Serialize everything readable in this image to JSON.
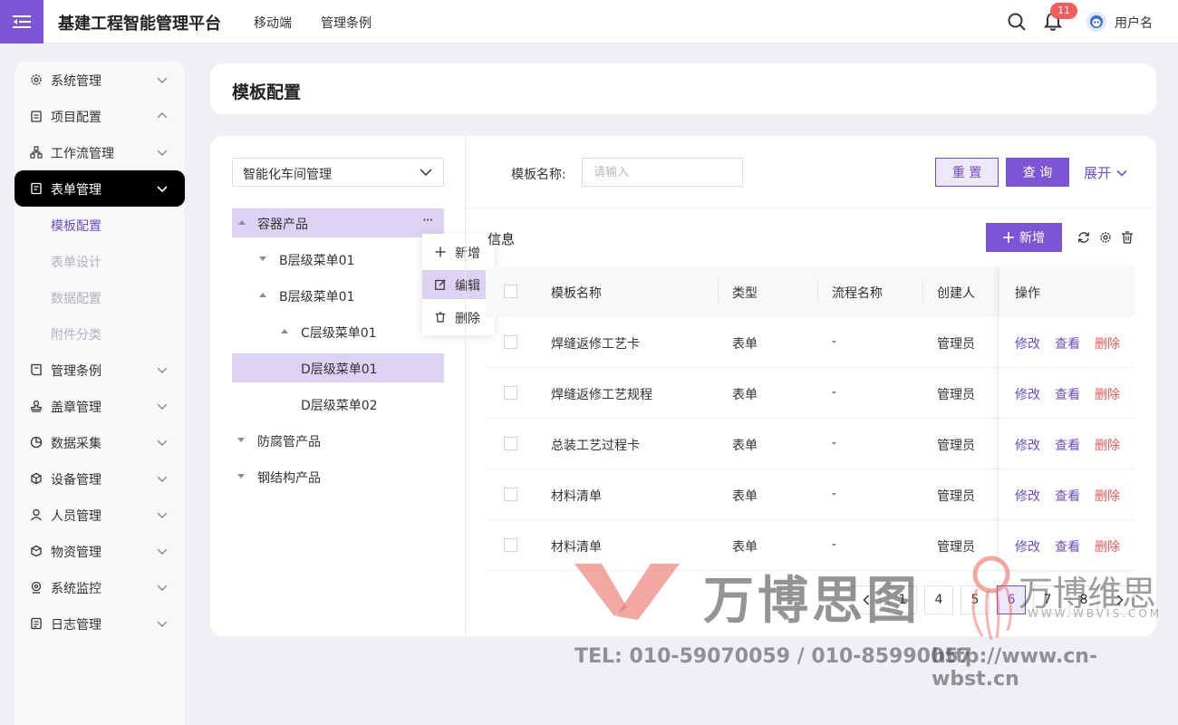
{
  "app": {
    "title": "基建工程智能管理平台"
  },
  "topnav": [
    "移动端",
    "管理条例"
  ],
  "header": {
    "notification_count": "11",
    "username": "用户名"
  },
  "sidebar": {
    "items": [
      {
        "label": "系统管理",
        "icon": "gear-icon"
      },
      {
        "label": "项目配置",
        "icon": "clipboard-icon"
      },
      {
        "label": "工作流管理",
        "icon": "workflow-icon"
      },
      {
        "label": "表单管理",
        "icon": "form-icon"
      },
      {
        "label": "管理条例",
        "icon": "rules-icon"
      },
      {
        "label": "盖章管理",
        "icon": "stamp-icon"
      },
      {
        "label": "数据采集",
        "icon": "pie-icon"
      },
      {
        "label": "设备管理",
        "icon": "device-icon"
      },
      {
        "label": "人员管理",
        "icon": "person-icon"
      },
      {
        "label": "物资管理",
        "icon": "box-icon"
      },
      {
        "label": "系统监控",
        "icon": "monitor-icon"
      },
      {
        "label": "日志管理",
        "icon": "log-icon"
      }
    ],
    "subitems": [
      "模板配置",
      "表单设计",
      "数据配置",
      "附件分类"
    ]
  },
  "page": {
    "title": "模板配置"
  },
  "tree": {
    "select_value": "智能化车间管理",
    "nodes": [
      "容器产品",
      "B层级菜单01",
      "B层级菜单01",
      "C层级菜单01",
      "D层级菜单01",
      "D层级菜单02",
      "防腐管产品",
      "钢结构产品"
    ],
    "more": "···",
    "context_menu": [
      "新增",
      "编辑",
      "删除"
    ]
  },
  "filter": {
    "label": "模板名称:",
    "placeholder": "请输入",
    "reset": "重 置",
    "query": "查 询",
    "expand": "展开"
  },
  "section": {
    "title": "信息",
    "add": "新增"
  },
  "table": {
    "columns": [
      "模板名称",
      "类型",
      "流程名称",
      "创建人",
      "操作"
    ],
    "rows": [
      {
        "name": "焊缝返修工艺卡",
        "type": "表单",
        "flow": "-",
        "creator": "管理员"
      },
      {
        "name": "焊缝返修工艺规程",
        "type": "表单",
        "flow": "-",
        "creator": "管理员"
      },
      {
        "name": "总装工艺过程卡",
        "type": "表单",
        "flow": "-",
        "creator": "管理员"
      },
      {
        "name": "材料清单",
        "type": "表单",
        "flow": "-",
        "creator": "管理员"
      },
      {
        "name": "材料清单",
        "type": "表单",
        "flow": "-",
        "creator": "管理员"
      }
    ],
    "actions": {
      "edit": "修改",
      "view": "查看",
      "delete": "删除"
    }
  },
  "pagination": {
    "pages": [
      "1",
      "4",
      "5",
      "6",
      "7",
      "8"
    ],
    "current": "6"
  },
  "watermark": {
    "brand_cn": "万博思图",
    "brand_cn2": "万博维思",
    "brand_en": "WWW.WBVIS.COM",
    "tel": "TEL: 010-59070059 / 010-85990057",
    "url": "http://www.cn-wbst.cn"
  },
  "colors": {
    "primary": "#7b55d4",
    "danger": "#ef5b5b",
    "highlight": "#dcd3f3"
  }
}
